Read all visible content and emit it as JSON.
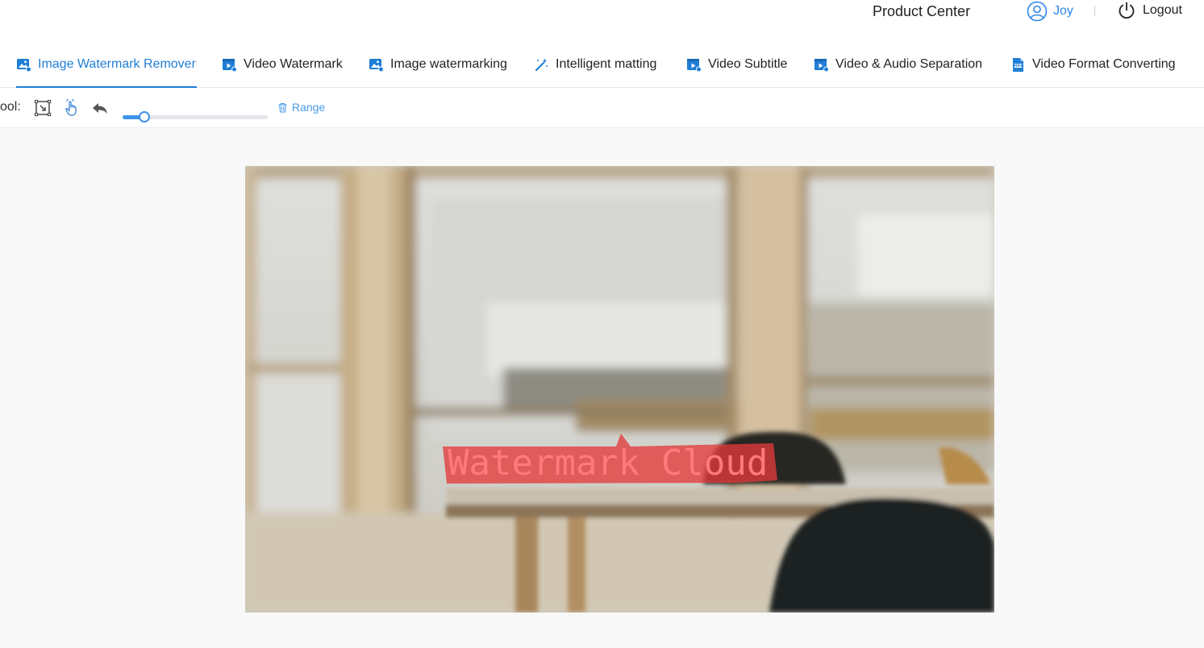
{
  "header": {
    "product_center": "Product Center",
    "user_name": "Joy",
    "logout_label": "Logout"
  },
  "tabs": [
    {
      "label": "Image Watermark Remover",
      "icon": "image-icon",
      "active": true
    },
    {
      "label": "Video Watermark",
      "icon": "video-icon",
      "active": false
    },
    {
      "label": "Image watermarking",
      "icon": "image-icon",
      "active": false
    },
    {
      "label": "Intelligent matting",
      "icon": "magic-wand-icon",
      "active": false
    },
    {
      "label": "Video Subtitle",
      "icon": "video-icon",
      "active": false
    },
    {
      "label": "Video & Audio Separation",
      "icon": "video-icon",
      "active": false
    },
    {
      "label": "Video Format Converting",
      "icon": "mp4-file-icon",
      "active": false
    }
  ],
  "toolbar": {
    "tool_label": "ool:",
    "brush_size_fraction": 0.11,
    "range_label": "Range"
  },
  "canvas": {
    "watermark_text": "Watermark Cloud",
    "mask_color": "#e23b3b"
  },
  "colors": {
    "accent": "#1f7ed6",
    "link": "#4a9be8"
  }
}
